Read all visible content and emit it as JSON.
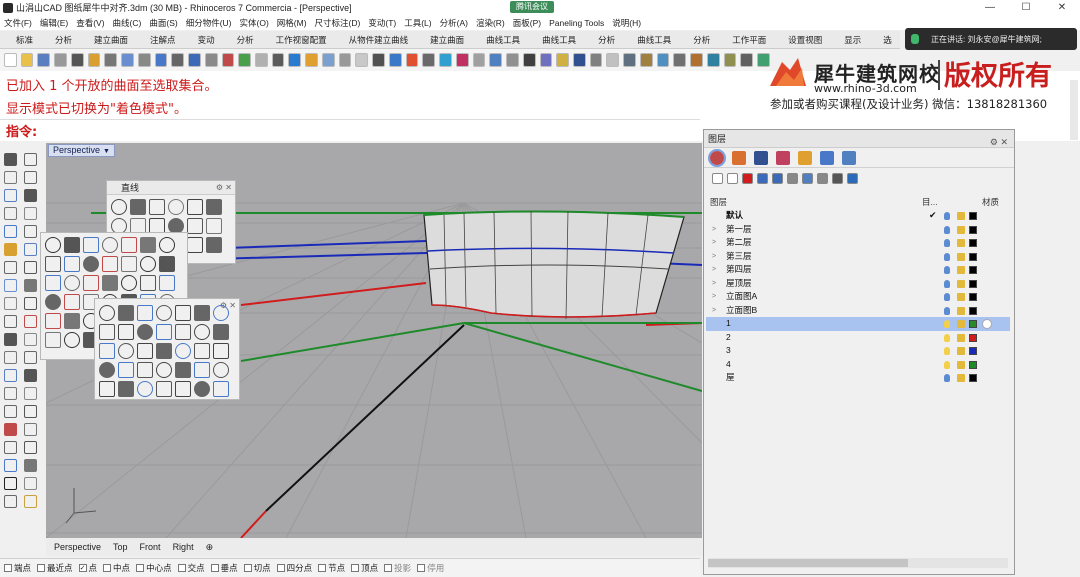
{
  "window": {
    "title": "山涓山CAD 图纸犀牛中对齐.3dm (30 MB) - Rhinoceros 7 Commercia - [Perspective]",
    "meeting_badge": "腾讯会议",
    "minimize": "—",
    "maximize": "☐",
    "close": "✕"
  },
  "menu": [
    "文件(F)",
    "编辑(E)",
    "查看(V)",
    "曲线(C)",
    "曲面(S)",
    "细分物件(U)",
    "实体(O)",
    "网格(M)",
    "尺寸标注(D)",
    "变动(T)",
    "工具(L)",
    "分析(A)",
    "渲染(R)",
    "面板(P)",
    "Paneling Tools",
    "说明(H)"
  ],
  "tabs": [
    "标准",
    "分析",
    "建立曲面",
    "注解点",
    "变动",
    "分析",
    "工作视窗配置",
    "从物件建立曲线",
    "建立曲面",
    "曲线工具",
    "曲线工具",
    "分析",
    "曲线工具",
    "分析",
    "工作平面",
    "设置视图",
    "显示",
    "选"
  ],
  "notification": {
    "text": "正在讲话: 刘永安@犀牛建筑网;"
  },
  "command": {
    "line1": "已加入 1 个开放的曲面至选取集合。",
    "line2": "显示模式已切换为\"着色模式\"。",
    "prompt": "指令:"
  },
  "watermark": {
    "brand": "犀牛建筑网校",
    "url": "www.rhino-3d.com",
    "rights": "版权所有",
    "contact": "参加或者购买课程(及设计业务) 微信：13818281360"
  },
  "viewport": {
    "label": "Perspective"
  },
  "panel_line": {
    "title": "直线"
  },
  "layers": {
    "title": "图层",
    "col_name": "图层",
    "col_current": "目...",
    "col_material": "材质",
    "rows": [
      {
        "name": "默认",
        "bold": true,
        "expand": "",
        "current": "✔",
        "color": "#000000",
        "bulb": "#5b8bd0",
        "selected": false
      },
      {
        "name": "第一层",
        "expand": ">",
        "current": "",
        "color": "#000000",
        "bulb": "#5b8bd0",
        "selected": false
      },
      {
        "name": "第二层",
        "expand": ">",
        "current": "",
        "color": "#000000",
        "bulb": "#5b8bd0",
        "selected": false
      },
      {
        "name": "第三层",
        "expand": ">",
        "current": "",
        "color": "#000000",
        "bulb": "#5b8bd0",
        "selected": false
      },
      {
        "name": "第四层",
        "expand": ">",
        "current": "",
        "color": "#000000",
        "bulb": "#5b8bd0",
        "selected": false
      },
      {
        "name": "屋顶层",
        "expand": ">",
        "current": "",
        "color": "#000000",
        "bulb": "#5b8bd0",
        "selected": false
      },
      {
        "name": "立面图A",
        "expand": ">",
        "current": "",
        "color": "#000000",
        "bulb": "#5b8bd0",
        "selected": false
      },
      {
        "name": "立面图B",
        "expand": ">",
        "current": "",
        "color": "#000000",
        "bulb": "#5b8bd0",
        "selected": false
      },
      {
        "name": "1",
        "expand": "",
        "current": "",
        "color": "#2a8a2a",
        "bulb": "#f2d04a",
        "selected": true
      },
      {
        "name": "2",
        "expand": "",
        "current": "",
        "color": "#d01c1c",
        "bulb": "#f2d04a",
        "selected": false
      },
      {
        "name": "3",
        "expand": "",
        "current": "",
        "color": "#1a2ab8",
        "bulb": "#f2d04a",
        "selected": false
      },
      {
        "name": "4",
        "expand": "",
        "current": "",
        "color": "#1f8a2a",
        "bulb": "#f2d04a",
        "selected": false
      },
      {
        "name": "屋",
        "expand": "",
        "current": "",
        "color": "#000000",
        "bulb": "#5b8bd0",
        "selected": false
      }
    ]
  },
  "viewport_tabs": [
    "Perspective",
    "Top",
    "Front",
    "Right",
    "⊕"
  ],
  "osnaps": [
    {
      "label": "端点",
      "checked": false,
      "dim": false
    },
    {
      "label": "最近点",
      "checked": false,
      "dim": false
    },
    {
      "label": "点",
      "checked": true,
      "dim": false
    },
    {
      "label": "中点",
      "checked": false,
      "dim": false
    },
    {
      "label": "中心点",
      "checked": false,
      "dim": false
    },
    {
      "label": "交点",
      "checked": false,
      "dim": false
    },
    {
      "label": "垂点",
      "checked": false,
      "dim": false
    },
    {
      "label": "切点",
      "checked": false,
      "dim": false
    },
    {
      "label": "四分点",
      "checked": false,
      "dim": false
    },
    {
      "label": "节点",
      "checked": false,
      "dim": false
    },
    {
      "label": "顶点",
      "checked": false,
      "dim": false
    },
    {
      "label": "投影",
      "checked": false,
      "dim": true
    },
    {
      "label": "停用",
      "checked": false,
      "dim": true
    }
  ],
  "colors": {
    "viewport_bg": "#a8a8aa",
    "command_text": "#cc1a1a",
    "selection": "#a9c3f0"
  }
}
